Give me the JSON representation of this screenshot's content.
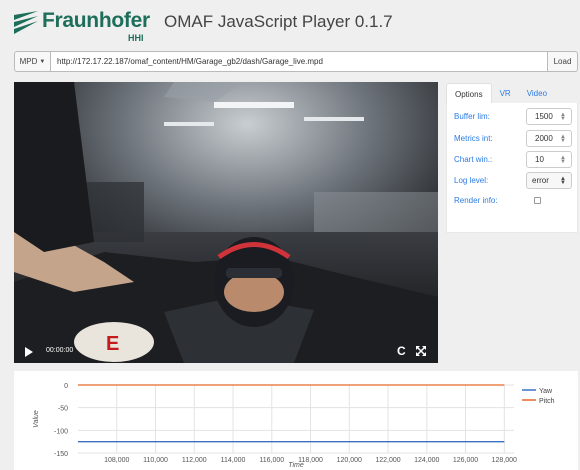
{
  "header": {
    "logo_name": "Fraunhofer",
    "logo_sub": "HHI",
    "title": "OMAF JavaScript Player 0.1.7",
    "brand_color": "#1d6e5a"
  },
  "urlbar": {
    "mpd_label": "MPD",
    "url": "http://172.17.22.187/omaf_content/HM/Garage_gb2/dash/Garage_live.mpd",
    "load_label": "Load"
  },
  "video": {
    "time": "00:00:00"
  },
  "panel": {
    "tabs": [
      {
        "label": "Options",
        "active": true
      },
      {
        "label": "VR",
        "active": false
      },
      {
        "label": "Video",
        "active": false
      }
    ],
    "options": {
      "buffer_label": "Buffer lim:",
      "buffer_value": "1500",
      "metrics_label": "Metrics int:",
      "metrics_value": "2000",
      "chart_label": "Chart win.:",
      "chart_value": "10",
      "log_label": "Log level:",
      "log_value": "error",
      "render_label": "Render info:",
      "render_checked": false
    }
  },
  "chart_data": {
    "type": "line",
    "xlabel": "Time",
    "ylabel": "Value",
    "xlim": [
      106000,
      128500
    ],
    "ylim": [
      -150,
      0
    ],
    "xticks": [
      108000,
      110000,
      112000,
      114000,
      116000,
      118000,
      120000,
      122000,
      124000,
      126000,
      128000
    ],
    "xtick_labels": [
      "108,000",
      "110,000",
      "112,000",
      "114,000",
      "116,000",
      "118,000",
      "120,000",
      "122,000",
      "124,000",
      "126,000",
      "128,000"
    ],
    "yticks": [
      0,
      -50,
      -100,
      -150
    ],
    "ytick_labels": [
      "0",
      "-50",
      "-100",
      "-150"
    ],
    "grid": true,
    "legend_position": "right",
    "series": [
      {
        "name": "Yaw",
        "color": "#3a6fc4",
        "x": [
          106000,
          128000
        ],
        "y": [
          -125,
          -125
        ]
      },
      {
        "name": "Pitch",
        "color": "#e8692a",
        "x": [
          106000,
          128000
        ],
        "y": [
          0,
          0
        ]
      }
    ]
  }
}
